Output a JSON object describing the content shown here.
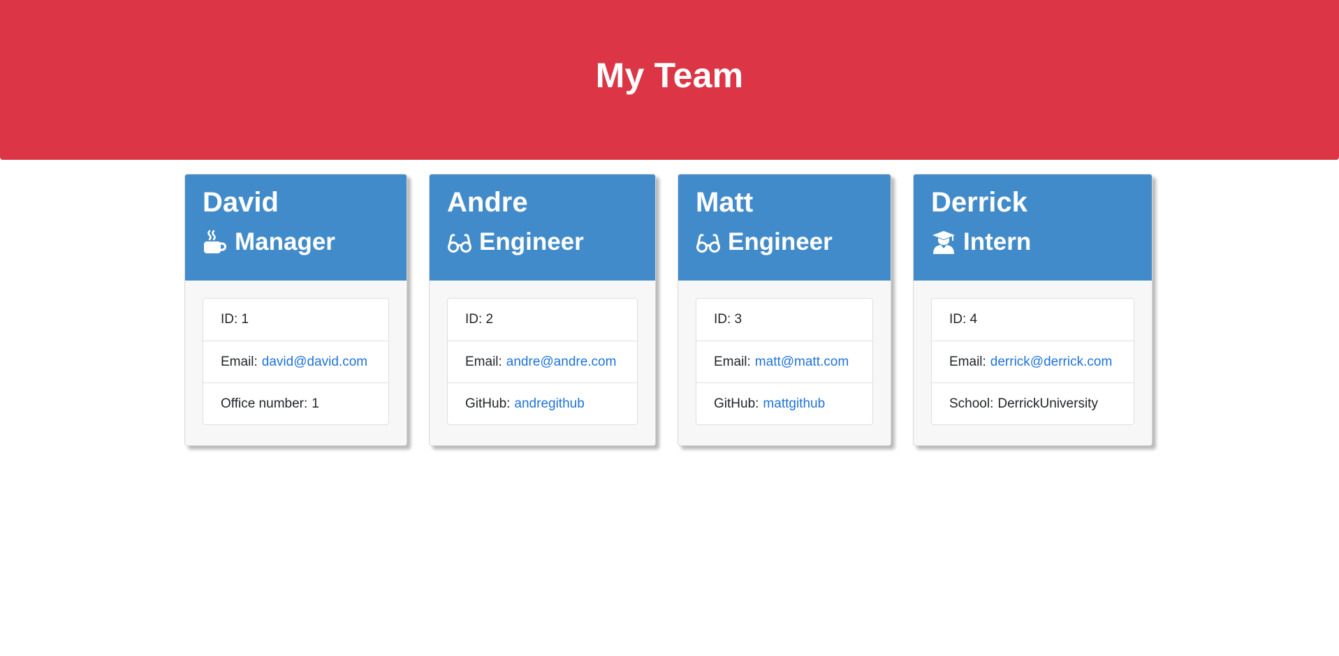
{
  "header": {
    "title": "My Team"
  },
  "team": [
    {
      "name": "David",
      "role": "Manager",
      "icon": "coffee-mug-icon",
      "id_label": "ID: 1",
      "email_label": "Email:",
      "email": "david@david.com",
      "extra_label": "Office number:",
      "extra_value": "1",
      "extra_is_link": false
    },
    {
      "name": "Andre",
      "role": "Engineer",
      "icon": "glasses-icon",
      "id_label": "ID: 2",
      "email_label": "Email:",
      "email": "andre@andre.com",
      "extra_label": "GitHub:",
      "extra_value": "andregithub",
      "extra_is_link": true
    },
    {
      "name": "Matt",
      "role": "Engineer",
      "icon": "glasses-icon",
      "id_label": "ID: 3",
      "email_label": "Email:",
      "email": "matt@matt.com",
      "extra_label": "GitHub:",
      "extra_value": "mattgithub",
      "extra_is_link": true
    },
    {
      "name": "Derrick",
      "role": "Intern",
      "icon": "graduate-icon",
      "id_label": "ID: 4",
      "email_label": "Email:",
      "email": "derrick@derrick.com",
      "extra_label": "School:",
      "extra_value": "DerrickUniversity",
      "extra_is_link": false
    }
  ],
  "colors": {
    "header_bg": "#dc3545",
    "card_header_bg": "#428bca",
    "link": "#1e73d8"
  }
}
